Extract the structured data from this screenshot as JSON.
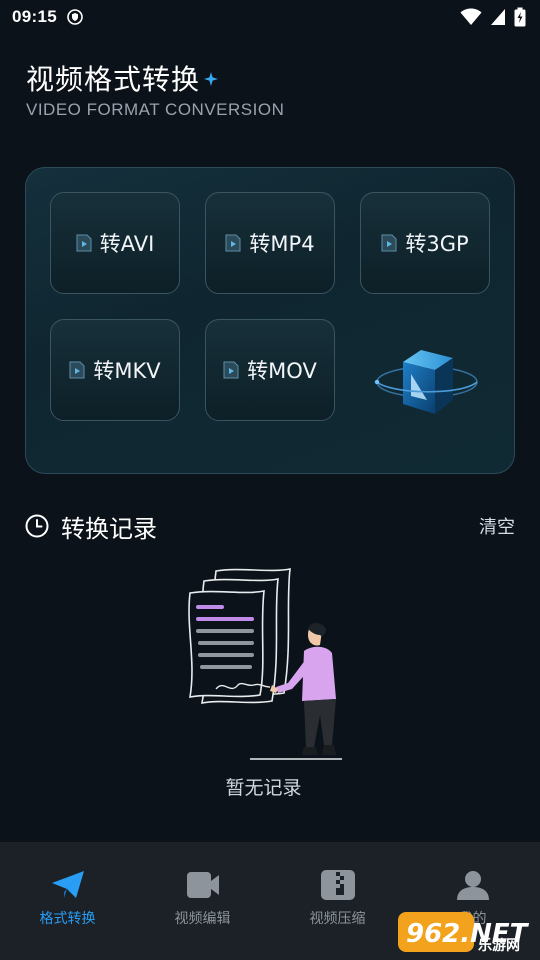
{
  "status": {
    "time": "09:15"
  },
  "header": {
    "title": "视频格式转换",
    "subtitle": "VIDEO FORMAT CONVERSION"
  },
  "formats": [
    {
      "label": "转AVI"
    },
    {
      "label": "转MP4"
    },
    {
      "label": "转3GP"
    },
    {
      "label": "转MKV"
    },
    {
      "label": "转MOV"
    }
  ],
  "history": {
    "title": "转换记录",
    "clear_label": "清空",
    "empty_text": "暂无记录"
  },
  "nav": [
    {
      "label": "格式转换",
      "icon": "paper-plane-icon",
      "active": true
    },
    {
      "label": "视频编辑",
      "icon": "video-camera-icon",
      "active": false
    },
    {
      "label": "视频压缩",
      "icon": "zip-file-icon",
      "active": false
    },
    {
      "label": "我的",
      "icon": "user-icon",
      "active": false
    }
  ],
  "watermark": {
    "text": "962.NET",
    "subtext": "乐游网"
  },
  "colors": {
    "accent": "#2a9df4",
    "background": "#0c1219",
    "card_border": "#2c4a58"
  }
}
